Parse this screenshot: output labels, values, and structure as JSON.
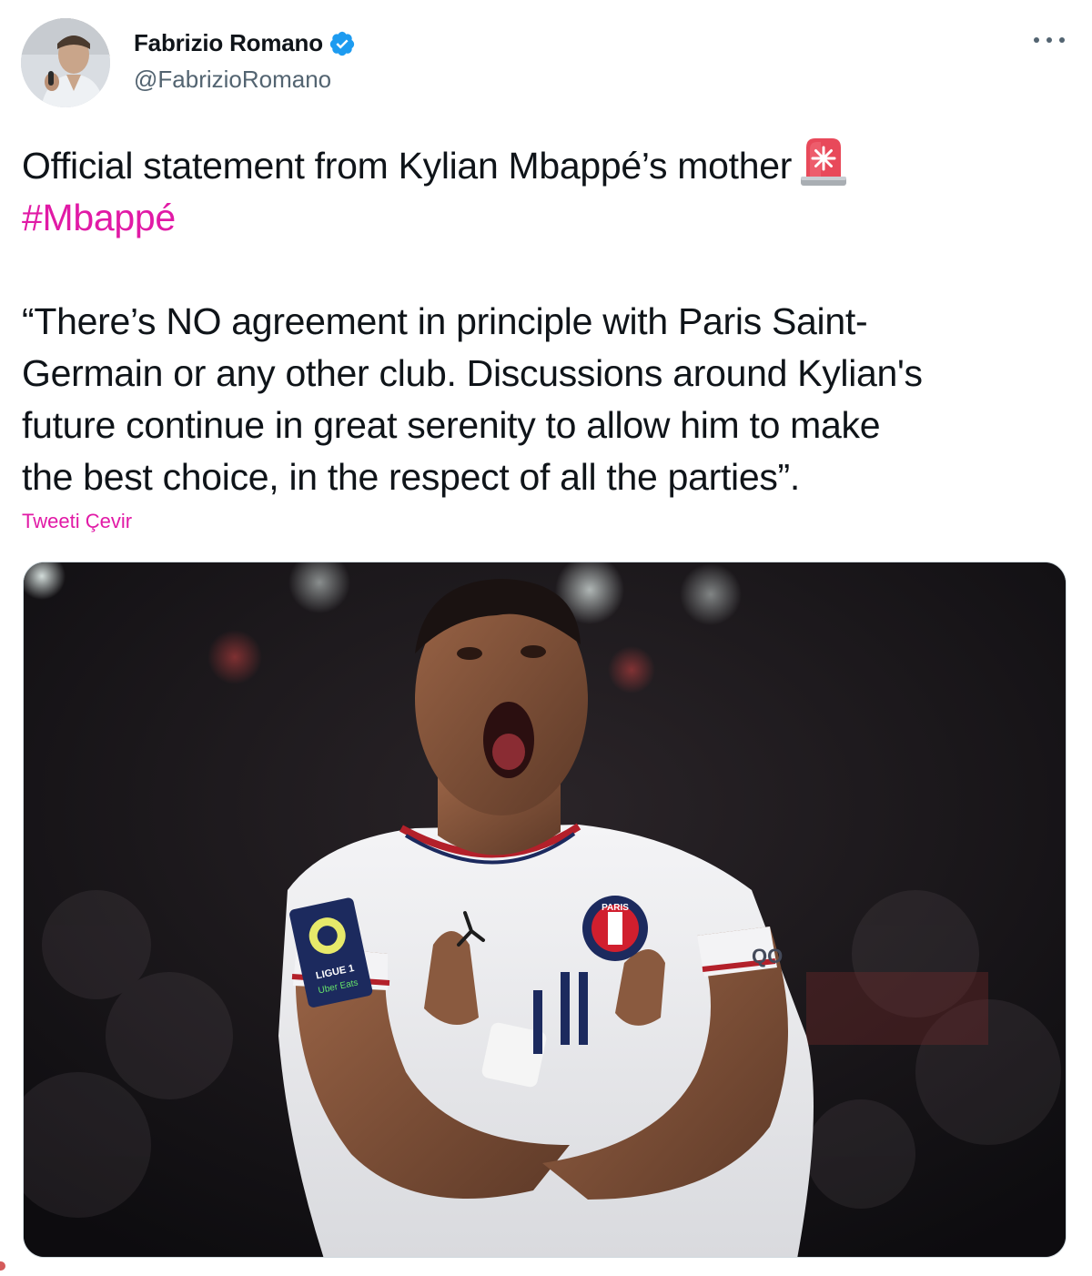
{
  "author": {
    "display_name": "Fabrizio Romano",
    "handle": "@FabrizioRomano",
    "verified": true
  },
  "tweet": {
    "lines": [
      "Official statement from Kylian Mbappé’s mother",
      "“There’s NO agreement in principle with Paris Saint-",
      "Germain or any other club. Discussions around Kylian's",
      "future continue in great serenity to allow him to make",
      "the best choice, in the respect of all the parties”."
    ],
    "hashtag": "#Mbappé",
    "emoji": "rotating-light-icon",
    "translate_label": "Tweeti Çevir"
  },
  "media": {
    "photo_text": {
      "league_badge_line1": "LIGUE 1",
      "league_badge_line2": "Uber Eats",
      "club_crest_text": "PARIS",
      "sponsor_partial": "QO"
    }
  },
  "colors": {
    "accent": "#e11aa6",
    "verified": "#1d9bf0",
    "text_primary": "#0f1419",
    "text_secondary": "#536471"
  }
}
